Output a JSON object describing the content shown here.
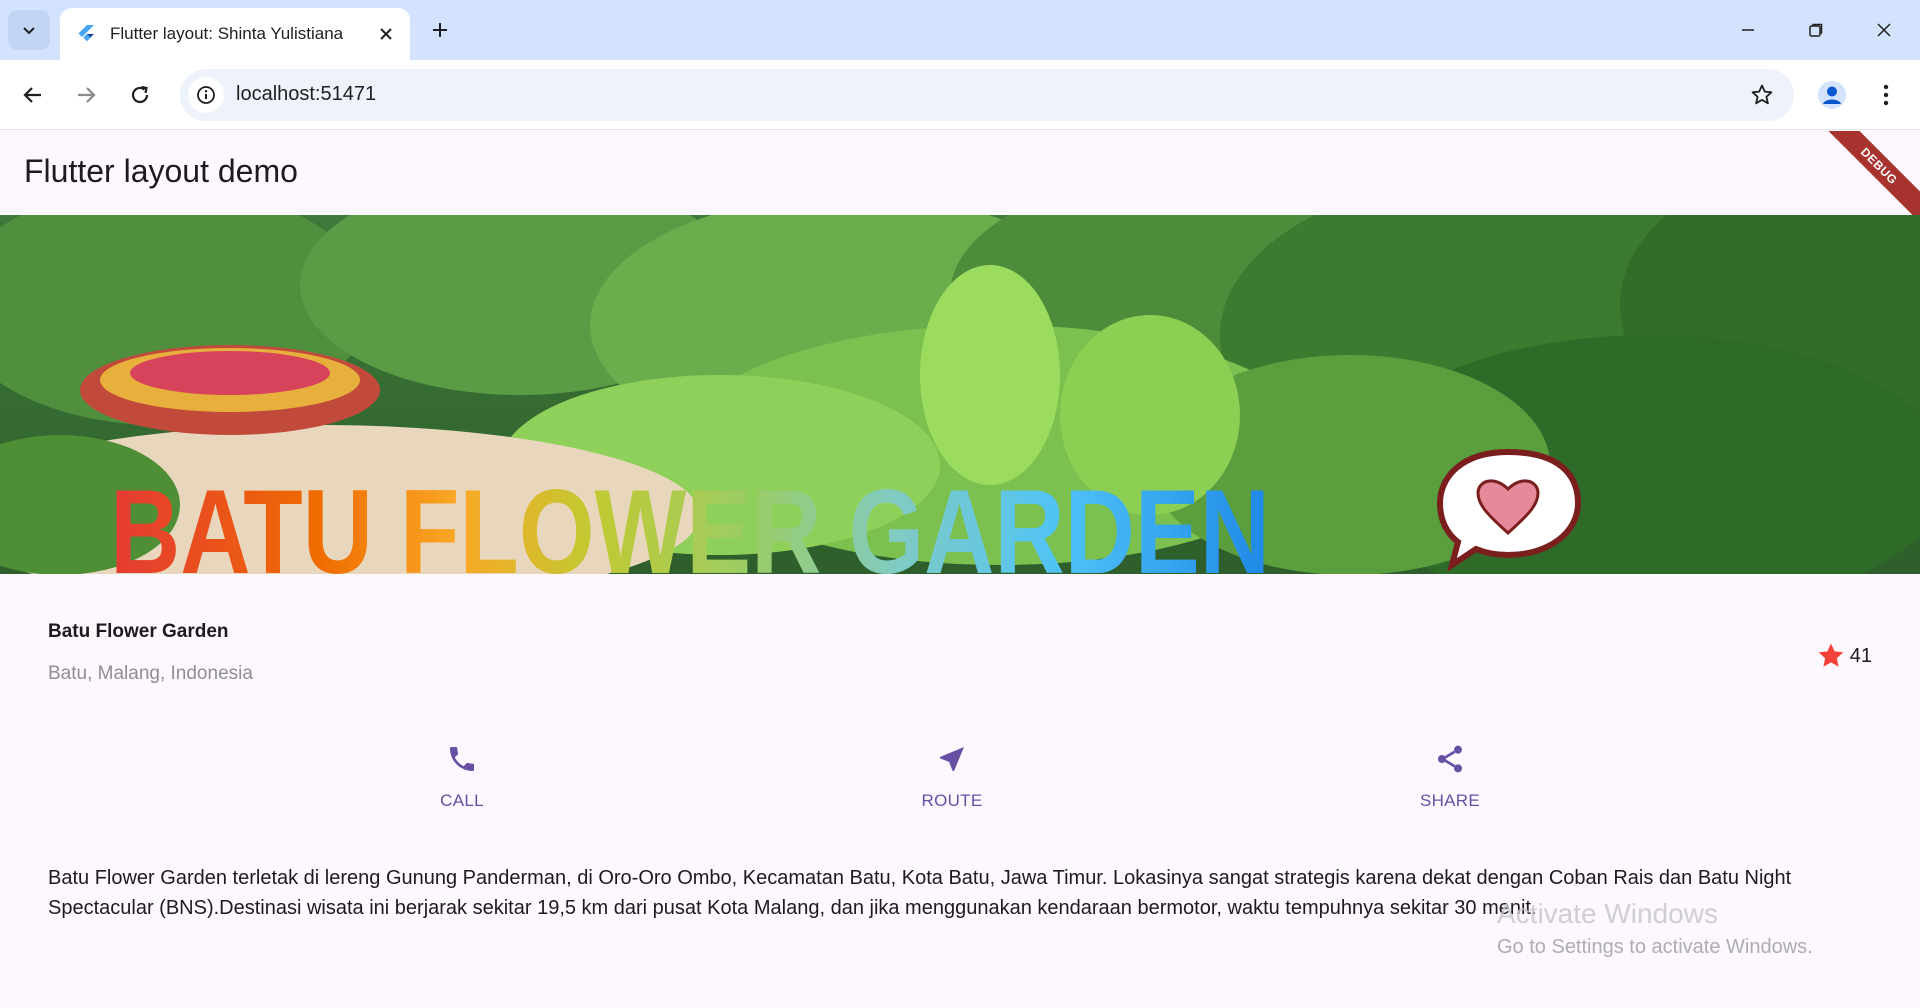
{
  "browser": {
    "tab_title": "Flutter layout: Shinta Yulistiana",
    "url": "localhost:51471",
    "icons": [
      "chevron-down-icon",
      "flutter-icon",
      "close-icon",
      "plus-icon",
      "minimize-icon",
      "restore-icon",
      "window-close-icon",
      "back-icon",
      "forward-icon",
      "reload-icon",
      "info-icon",
      "star-outline-icon",
      "profile-icon",
      "kebab-menu-icon"
    ]
  },
  "app": {
    "appbar_title": "Flutter layout demo",
    "debug_banner": "DEBUG",
    "hero_sign_text": "BATU FLOWER GARDEN",
    "place": {
      "name": "Batu Flower Garden",
      "location": "Batu, Malang, Indonesia",
      "rating_count": "41"
    },
    "actions": [
      {
        "label": "CALL",
        "icon": "phone-icon"
      },
      {
        "label": "ROUTE",
        "icon": "navigation-icon"
      },
      {
        "label": "SHARE",
        "icon": "share-icon"
      }
    ],
    "description": "Batu Flower Garden terletak di lereng Gunung Panderman, di Oro-Oro Ombo, Kecamatan Batu, Kota Batu, Jawa Timur. Lokasinya sangat strategis karena dekat dengan Coban Rais dan Batu Night Spectacular (BNS).Destinasi wisata ini berjarak sekitar 19,5 km dari pusat Kota Malang, dan jika menggunakan kendaraan bermotor, waktu tempuhnya sekitar 30 menit."
  },
  "watermark": {
    "title": "Activate Windows",
    "subtitle": "Go to Settings to activate Windows."
  },
  "colors": {
    "accent": "#6750a4",
    "star": "#f44336",
    "app_background": "#fdf7ff",
    "tabbar": "#d3e3fd"
  }
}
